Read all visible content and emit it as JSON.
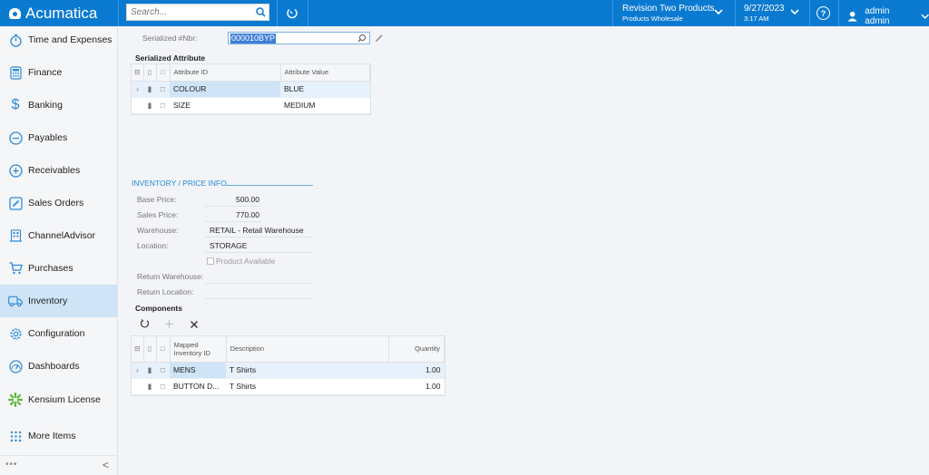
{
  "topbar": {
    "brand": "Acumatica",
    "search_placeholder": "Search...",
    "company_name": "Revision Two Products",
    "company_branch": "Products Wholesale",
    "date": "9/27/2023",
    "time": "3:17 AM",
    "help_label": "?",
    "user_name": "admin admin"
  },
  "sidebar": {
    "items": [
      {
        "label": "Time and Expenses",
        "icon": "stopwatch-icon"
      },
      {
        "label": "Finance",
        "icon": "calculator-icon"
      },
      {
        "label": "Banking",
        "icon": "dollar-icon"
      },
      {
        "label": "Payables",
        "icon": "minus-circle-icon"
      },
      {
        "label": "Receivables",
        "icon": "plus-circle-icon"
      },
      {
        "label": "Sales Orders",
        "icon": "edit-icon"
      },
      {
        "label": "ChannelAdvisor",
        "icon": "building-icon"
      },
      {
        "label": "Purchases",
        "icon": "cart-icon"
      },
      {
        "label": "Inventory",
        "icon": "truck-icon",
        "active": true
      },
      {
        "label": "Configuration",
        "icon": "gear-icon"
      },
      {
        "label": "Dashboards",
        "icon": "gauge-icon"
      },
      {
        "label": "Kensium License",
        "icon": "kensium-icon"
      },
      {
        "label": "More Items",
        "icon": "grid-dots-icon"
      }
    ],
    "more_dots": "•••",
    "collapse": "<"
  },
  "form": {
    "serialized_label": "Serialized #Nbr:",
    "serialized_value": "000010BYP"
  },
  "serialized_attribute": {
    "title": "Serialized Attribute",
    "columns": [
      "Attribute ID",
      "Attribute Value"
    ],
    "rows": [
      {
        "id": "COLOUR",
        "value": "BLUE",
        "selected": true
      },
      {
        "id": "SIZE",
        "value": "MEDIUM"
      }
    ]
  },
  "inventory": {
    "title": "INVENTORY / PRICE INFO",
    "base_price_label": "Base Price:",
    "base_price": "500.00",
    "sales_price_label": "Sales Price:",
    "sales_price": "770.00",
    "warehouse_label": "Warehouse:",
    "warehouse": "RETAIL - Retail Warehouse",
    "location_label": "Location:",
    "location": "STORAGE",
    "product_available_label": "Product Available",
    "product_available": false,
    "return_warehouse_label": "Return Warehouse:",
    "return_warehouse": "",
    "return_location_label": "Return Location:",
    "return_location": ""
  },
  "components": {
    "title": "Components",
    "columns": [
      "Mapped Inventory ID",
      "Description",
      "Quantity"
    ],
    "col_mapped_line1": "Mapped",
    "col_mapped_line2": "Inventory ID",
    "rows": [
      {
        "id": "MENS",
        "description": "T Shirts",
        "quantity": "1.00",
        "selected": true
      },
      {
        "id": "BUTTON D...",
        "description": "T Shirts",
        "quantity": "1.00"
      }
    ]
  }
}
